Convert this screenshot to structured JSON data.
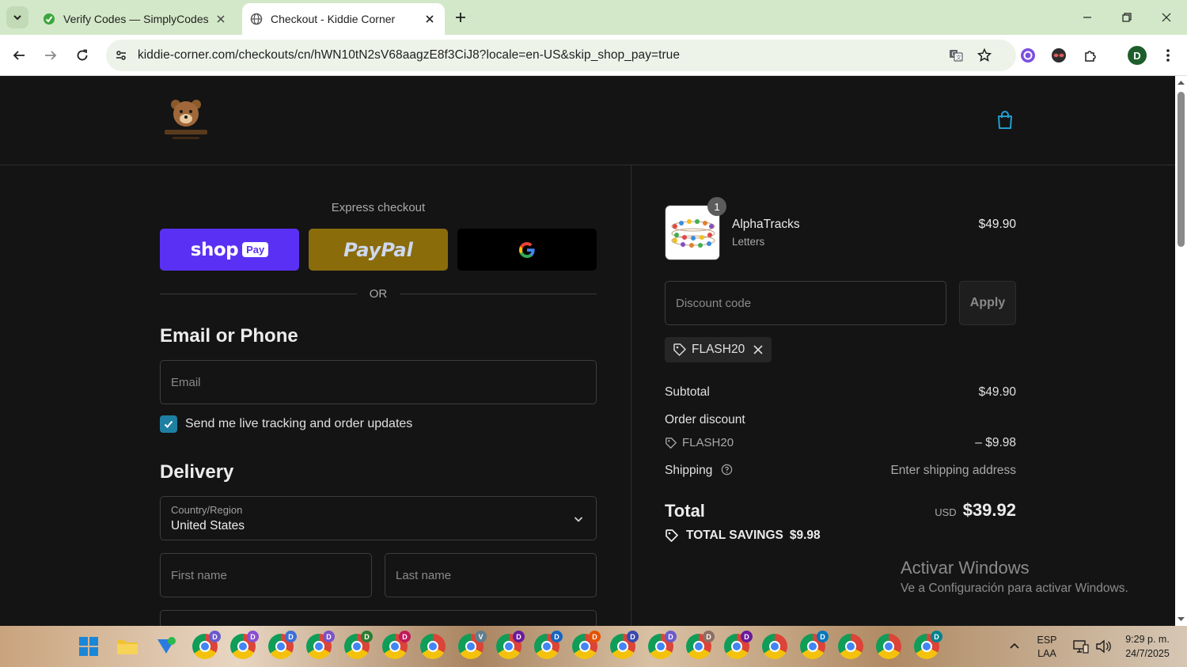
{
  "browser": {
    "tabs": [
      {
        "title": "Verify Codes — SimplyCodes",
        "active": false
      },
      {
        "title": "Checkout - Kiddie Corner",
        "active": true
      }
    ],
    "url": "kiddie-corner.com/checkouts/cn/hWN10tN2sV68aagzE8f3CiJ8?locale=en-US&skip_shop_pay=true",
    "profile_initial": "D"
  },
  "checkout": {
    "express_title": "Express checkout",
    "shop_pay": {
      "word": "shop",
      "badge": "Pay"
    },
    "paypal_label": "PayPal",
    "or_text": "OR",
    "contact_title": "Email or Phone",
    "email_placeholder": "Email",
    "tracking_label": "Send me live tracking and order updates",
    "tracking_checked": true,
    "delivery_title": "Delivery",
    "country_label": "Country/Region",
    "country_value": "United States",
    "first_name_placeholder": "First name",
    "last_name_placeholder": "Last name"
  },
  "summary": {
    "item": {
      "quantity": "1",
      "name": "AlphaTracks",
      "variant": "Letters",
      "price": "$49.90"
    },
    "discount_placeholder": "Discount code",
    "apply_label": "Apply",
    "applied_code": "FLASH20",
    "subtotal_label": "Subtotal",
    "subtotal_value": "$49.90",
    "order_discount_label": "Order discount",
    "discount_code": "FLASH20",
    "discount_value": "– $9.98",
    "shipping_label": "Shipping",
    "shipping_value": "Enter shipping address",
    "total_label": "Total",
    "total_currency": "USD",
    "total_value": "$39.92",
    "savings_label": "TOTAL SAVINGS",
    "savings_value": "$9.98"
  },
  "watermark": {
    "title": "Activar Windows",
    "subtitle": "Ve a Configuración para activar Windows."
  },
  "taskbar": {
    "language": "ESP",
    "layout": "LAA",
    "time": "9:29 p. m.",
    "date": "24/7/2025",
    "chrome_badges": [
      "D",
      "D",
      "D",
      "D",
      "D",
      "D",
      "",
      "V",
      "D",
      "D",
      "D",
      "D",
      "D",
      "D",
      "D",
      "",
      "D",
      "",
      "",
      "D"
    ]
  },
  "colors": {
    "accent": "#1f7fa3",
    "shop_pay": "#5a31f4",
    "paypal": "#8a6c0b",
    "tab_strip": "#d3e8c8"
  }
}
